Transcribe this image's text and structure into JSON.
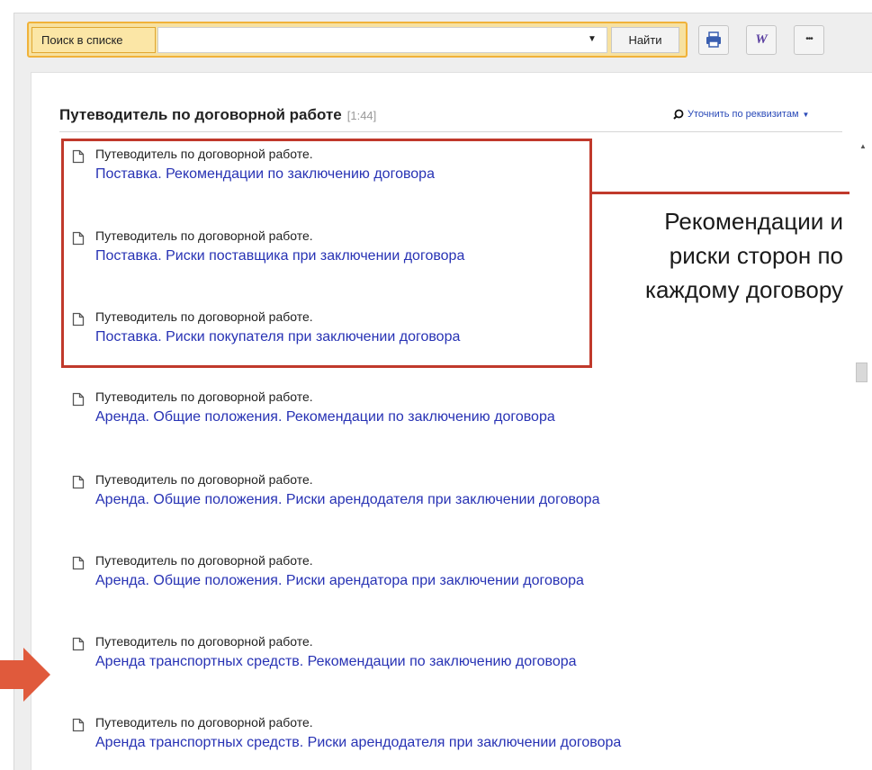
{
  "search": {
    "label": "Поиск в списке",
    "value": "",
    "find_button": "Найти"
  },
  "toolbar": {
    "print_icon": "printer-icon",
    "word_icon": "word-export-icon",
    "word_glyph": "W",
    "more_icon": "more-dots-icon",
    "more_glyph": "•••"
  },
  "list": {
    "title": "Путеводитель по договорной работе",
    "count": "[1:44]",
    "refine_label": "Уточнить по реквизитам",
    "items": [
      {
        "prefix": "Путеводитель по договорной работе.",
        "link": "Поставка. Рекомендации по заключению договора"
      },
      {
        "prefix": "Путеводитель по договорной работе.",
        "link": "Поставка. Риски поставщика при заключении договора"
      },
      {
        "prefix": "Путеводитель по договорной работе.",
        "link": "Поставка. Риски покупателя при заключении договора"
      },
      {
        "prefix": "Путеводитель по договорной работе.",
        "link": "Аренда. Общие положения. Рекомендации по заключению договора"
      },
      {
        "prefix": "Путеводитель по договорной работе.",
        "link": "Аренда. Общие положения. Риски арендодателя при заключении договора"
      },
      {
        "prefix": "Путеводитель по договорной работе.",
        "link": "Аренда. Общие положения. Риски арендатора при заключении договора"
      },
      {
        "prefix": "Путеводитель по договорной работе.",
        "link": "Аренда транспортных средств. Рекомендации по заключению договора"
      },
      {
        "prefix": "Путеводитель по договорной работе.",
        "link": "Аренда транспортных средств. Риски арендодателя при заключении договора"
      }
    ]
  },
  "callout": {
    "line1": "Рекомендации и",
    "line2": "риски сторон по",
    "line3": "каждому договору"
  },
  "colors": {
    "accent": "#f0b23a",
    "link": "#2732b4",
    "highlight": "#c0392b"
  }
}
